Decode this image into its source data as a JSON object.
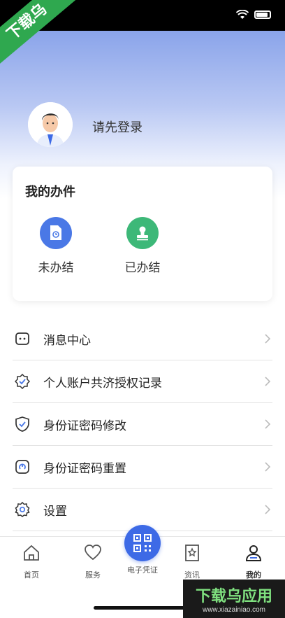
{
  "app": {
    "login_prompt": "请先登录",
    "corner_badge": "下载乌"
  },
  "my_tasks": {
    "title": "我的办件",
    "items": [
      {
        "label": "未办结",
        "icon": "document-clock-icon",
        "color": "#4a78e6"
      },
      {
        "label": "已办结",
        "icon": "stamp-icon",
        "color": "#3db878"
      }
    ]
  },
  "menu": {
    "items": [
      {
        "label": "消息中心",
        "icon": "message-icon"
      },
      {
        "label": "个人账户共济授权记录",
        "icon": "badge-check-icon"
      },
      {
        "label": "身份证密码修改",
        "icon": "shield-check-icon"
      },
      {
        "label": "身份证密码重置",
        "icon": "reset-icon"
      },
      {
        "label": "设置",
        "icon": "gear-icon"
      }
    ]
  },
  "tabbar": {
    "items": [
      {
        "label": "首页",
        "icon": "home-icon"
      },
      {
        "label": "服务",
        "icon": "heart-icon"
      },
      {
        "label": "电子凭证",
        "icon": "qrcode-icon"
      },
      {
        "label": "资讯",
        "icon": "bookmark-star-icon"
      },
      {
        "label": "我的",
        "icon": "user-icon",
        "active": true
      }
    ]
  },
  "watermark": {
    "title": "下载乌应用",
    "subtitle": "www.xiazainiao.com"
  },
  "colors": {
    "accent": "#3d6ae6",
    "green": "#3db878",
    "header_top": "#8aa4ea"
  }
}
